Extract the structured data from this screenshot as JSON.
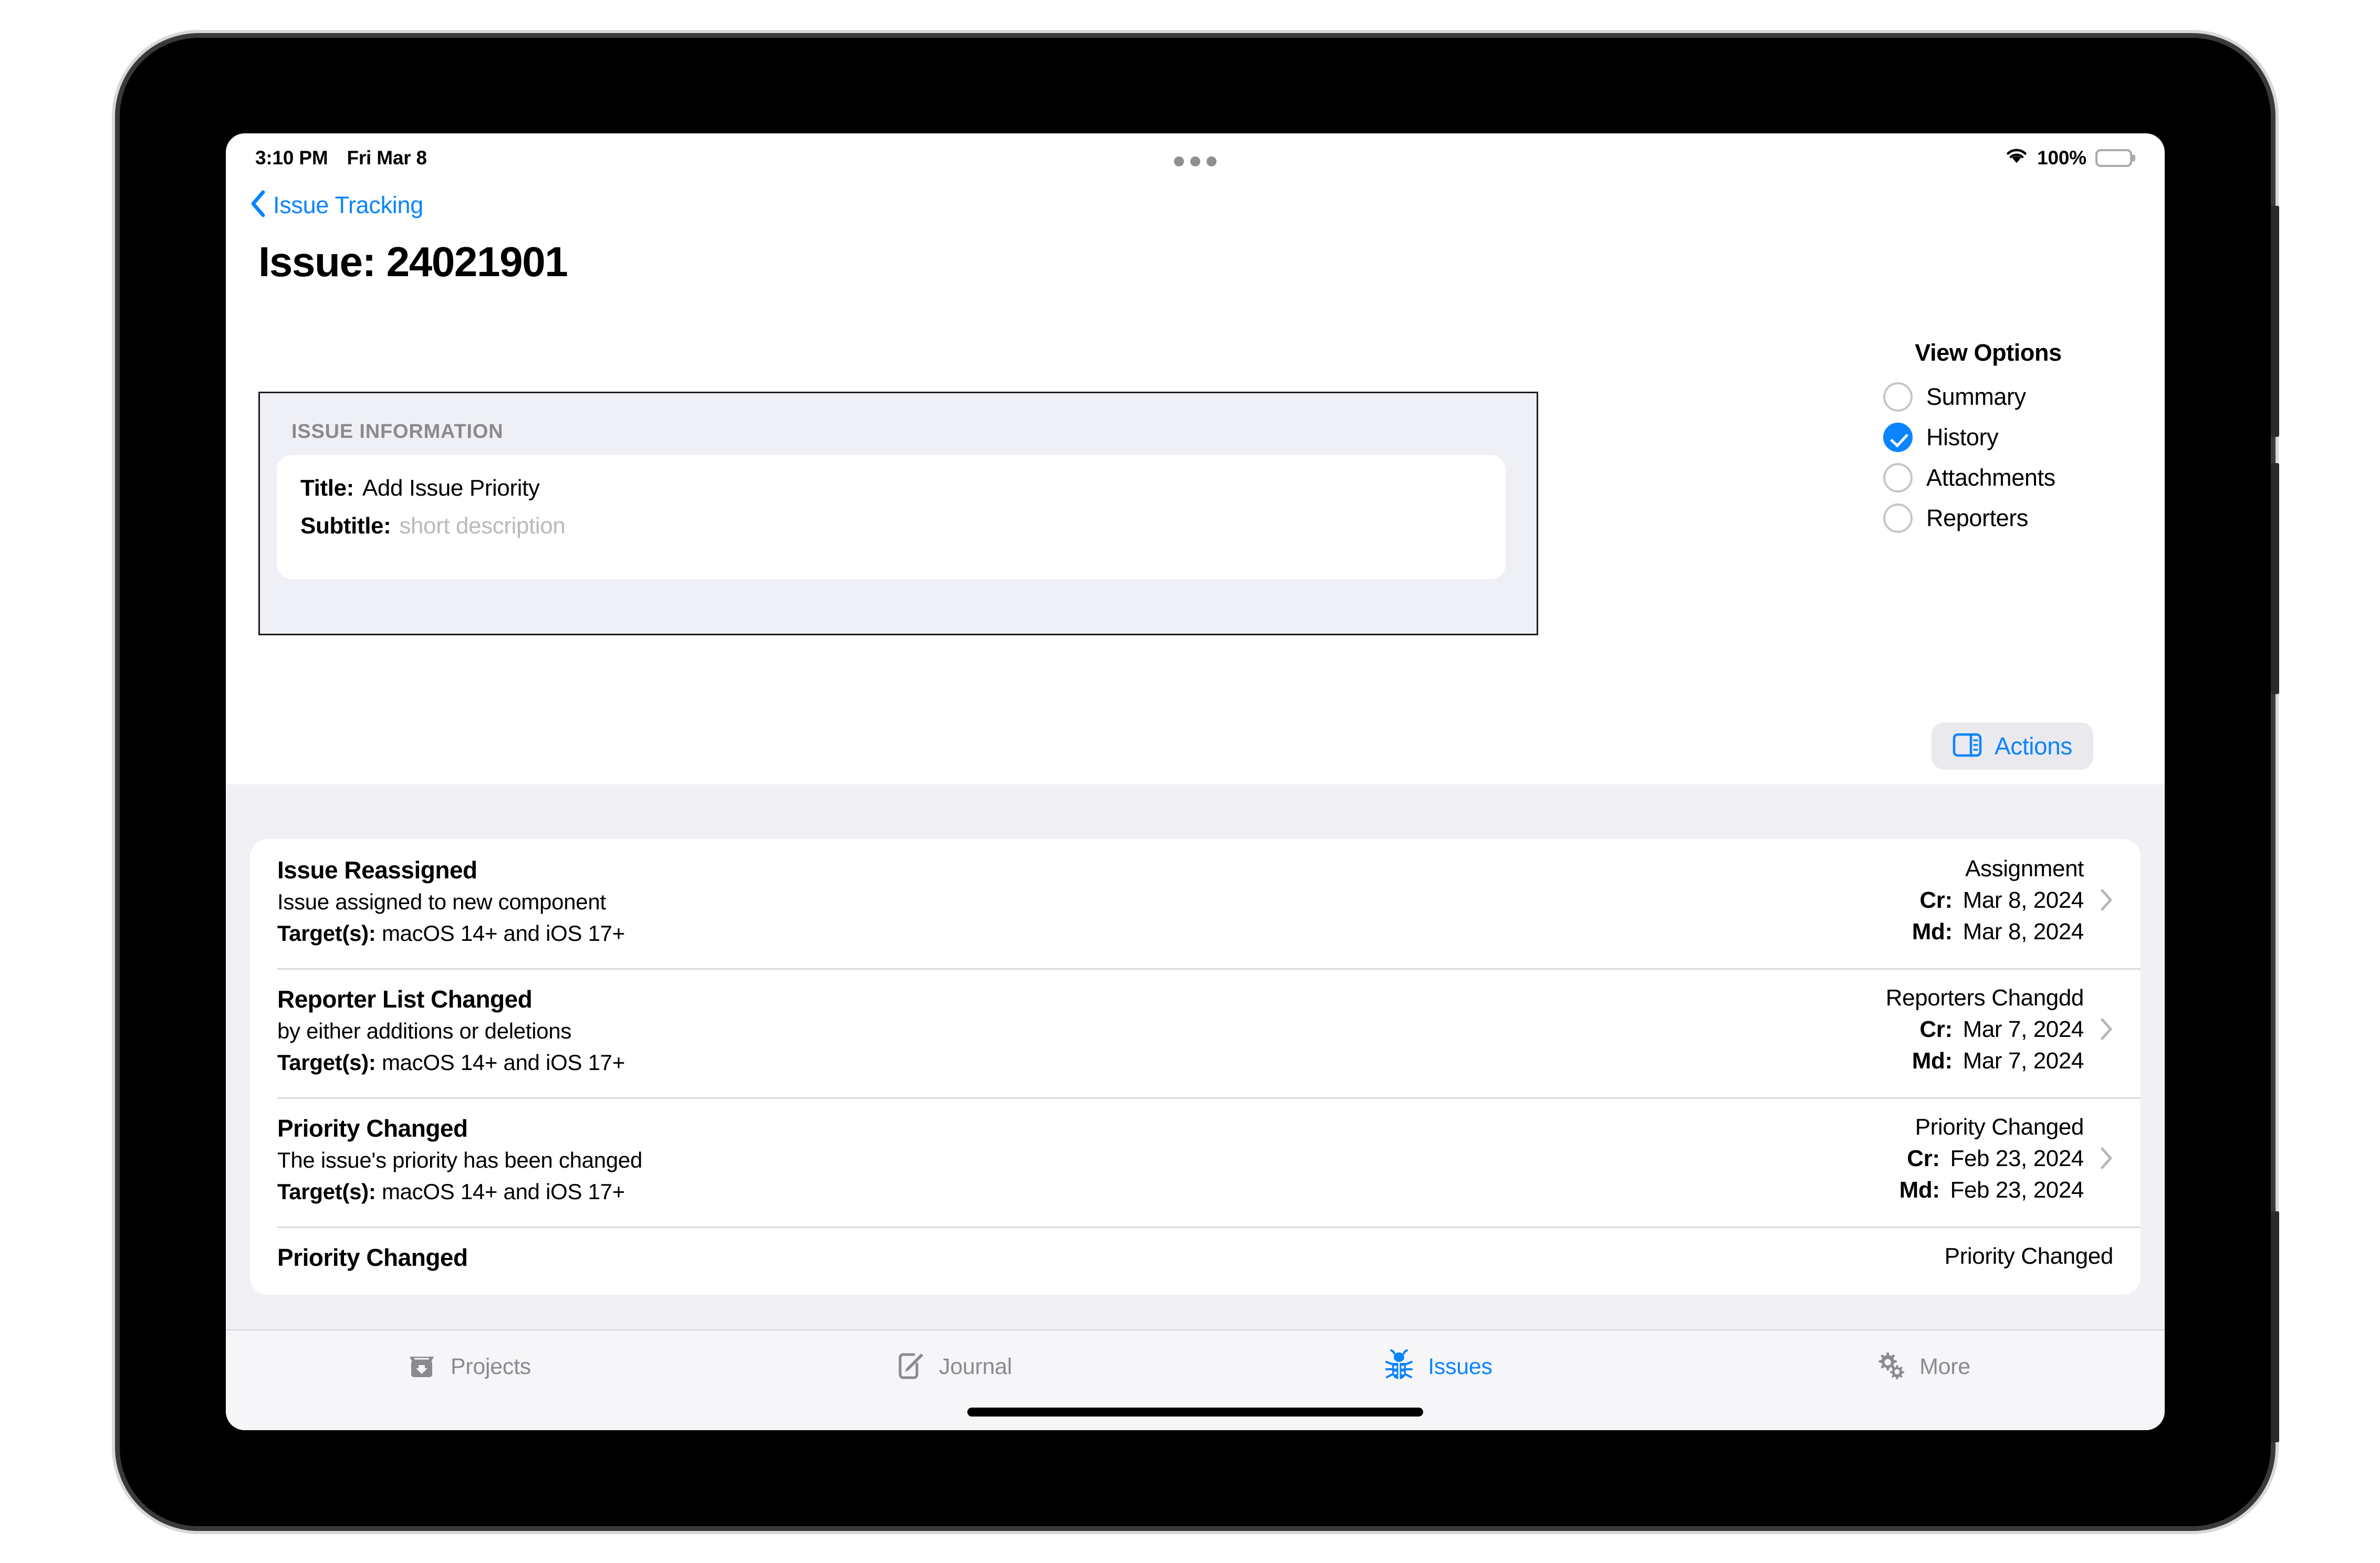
{
  "status_bar": {
    "time": "3:10 PM",
    "date": "Fri Mar 8",
    "battery_percent": "100%",
    "wifi_icon": "wifi-icon",
    "battery_icon": "battery-full-icon",
    "multitask_icon": "multitasking-dots-icon"
  },
  "nav": {
    "back_label": "Issue Tracking",
    "back_icon": "chevron-left-icon"
  },
  "page_title": "Issue: 24021901",
  "issue_info": {
    "heading": "ISSUE INFORMATION",
    "title_label": "Title:",
    "title_value": "Add Issue Priority",
    "subtitle_label": "Subtitle:",
    "subtitle_placeholder": "short description"
  },
  "view_options": {
    "title": "View Options",
    "items": [
      {
        "label": "Summary",
        "selected": false
      },
      {
        "label": "History",
        "selected": true
      },
      {
        "label": "Attachments",
        "selected": false
      },
      {
        "label": "Reporters",
        "selected": false
      }
    ]
  },
  "actions": {
    "label": "Actions",
    "icon": "sidebar-right-icon"
  },
  "history": {
    "targets_label": "Target(s):",
    "created_label": "Cr:",
    "modified_label": "Md:",
    "chevron_icon": "chevron-right-icon",
    "rows": [
      {
        "title": "Issue Reassigned",
        "description": "Issue assigned to new component",
        "targets": "macOS 14+ and iOS 17+",
        "category": "Assignment",
        "created": "Mar 8, 2024",
        "modified": "Mar 8, 2024"
      },
      {
        "title": "Reporter List Changed",
        "description": "by either additions or deletions",
        "targets": "macOS 14+ and iOS 17+",
        "category": "Reporters Changdd",
        "created": "Mar 7, 2024",
        "modified": "Mar 7, 2024"
      },
      {
        "title": "Priority Changed",
        "description": "The issue's priority has been changed",
        "targets": "macOS 14+ and iOS 17+",
        "category": "Priority Changed",
        "created": "Feb 23, 2024",
        "modified": "Feb 23, 2024"
      },
      {
        "title": "Priority Changed",
        "description": "",
        "targets": "",
        "category": "Priority Changed",
        "created": "",
        "modified": ""
      }
    ]
  },
  "tab_bar": {
    "items": [
      {
        "label": "Projects",
        "icon": "archivebox-icon",
        "active": false
      },
      {
        "label": "Journal",
        "icon": "square-pencil-icon",
        "active": false
      },
      {
        "label": "Issues",
        "icon": "ladybug-icon",
        "active": true
      },
      {
        "label": "More",
        "icon": "gears-icon",
        "active": false
      }
    ]
  },
  "colors": {
    "accent": "#0a84ff",
    "secondary_text": "#8a8a8f",
    "card_bg": "#eff0f5",
    "list_bg": "#f0f0f5"
  }
}
